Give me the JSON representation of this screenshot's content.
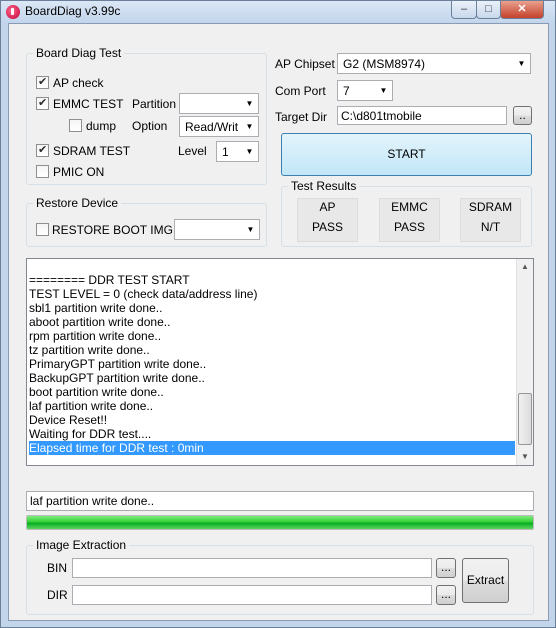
{
  "window": {
    "title": "BoardDiag v3.99c",
    "buttons": {
      "minimize": "–",
      "maximize": "□",
      "close": "✕"
    }
  },
  "board_diag": {
    "legend": "Board Diag Test",
    "ap_check": {
      "label": "AP check",
      "checked": true
    },
    "emmc_test": {
      "label": "EMMC TEST",
      "checked": true
    },
    "partition_label": "Partition",
    "partition_value": "",
    "dump": {
      "label": "dump",
      "checked": false
    },
    "option_label": "Option",
    "option_value": "Read/Writ",
    "sdram_test": {
      "label": "SDRAM TEST",
      "checked": true
    },
    "level_label": "Level",
    "level_value": "1",
    "pmic_on": {
      "label": "PMIC ON",
      "checked": false
    }
  },
  "restore": {
    "legend": "Restore Device",
    "restore_boot_img": {
      "label": "RESTORE BOOT IMG",
      "checked": false
    },
    "combo_value": ""
  },
  "ap_settings": {
    "chipset_label": "AP Chipset",
    "chipset_value": "G2 (MSM8974)",
    "com_port_label": "Com Port",
    "com_port_value": "7",
    "target_dir_label": "Target Dir",
    "target_dir_value": "C:\\d801tmobile",
    "browse_label": "..",
    "start_label": "START"
  },
  "test_results": {
    "legend": "Test Results",
    "items": [
      {
        "name": "AP",
        "value": "PASS"
      },
      {
        "name": "EMMC",
        "value": "PASS"
      },
      {
        "name": "SDRAM",
        "value": "N/T"
      }
    ]
  },
  "log": {
    "lines": [
      "======== DDR TEST START",
      "TEST LEVEL = 0 (check data/address line)",
      "sbl1 partition write done..",
      "aboot partition write done..",
      "rpm partition write done..",
      "tz partition write done..",
      "PrimaryGPT partition write done..",
      "BackupGPT partition write done..",
      "boot partition write done..",
      "laf partition write done..",
      "Device Reset!!",
      "Waiting for DDR test....",
      "Elapsed time for DDR test : 0min"
    ],
    "selected_index": 12,
    "scroll_up": "▲",
    "scroll_down": "▼"
  },
  "status": {
    "text": "laf partition write done..",
    "progress_percent": 100
  },
  "extraction": {
    "legend": "Image Extraction",
    "bin_label": "BIN",
    "bin_value": "",
    "dir_label": "DIR",
    "dir_value": "",
    "bin_browse": "...",
    "dir_browse": "...",
    "extract_label": "Extract"
  },
  "colors": {
    "selection": "#3399ff",
    "progress_green": "#06b025",
    "title_bar": "#c2d5ec",
    "close_button": "#c4412b"
  }
}
